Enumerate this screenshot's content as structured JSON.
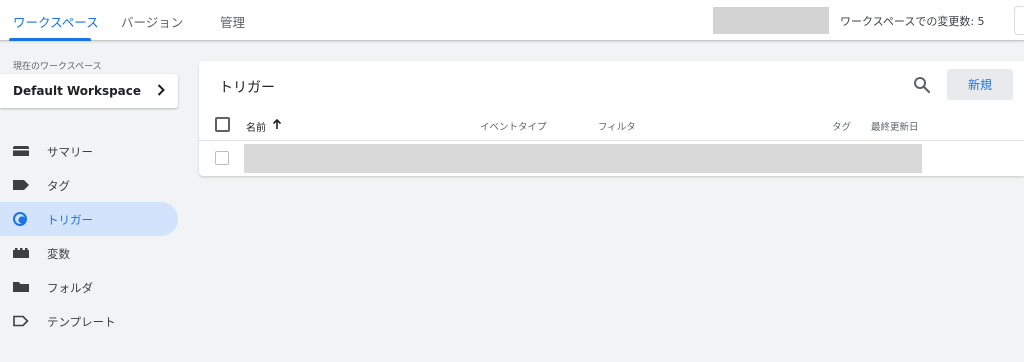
{
  "header": {
    "tabs": [
      {
        "label": "ワークスペース",
        "active": true
      },
      {
        "label": "バージョン",
        "active": false
      },
      {
        "label": "管理",
        "active": false
      }
    ],
    "variable_count_text": "ワークスペースでの変更数: 5"
  },
  "sidebar": {
    "workspace_caption": "現在のワークスペース",
    "workspace_name": "Default Workspace",
    "items": [
      {
        "label": "サマリー",
        "icon": "summary-folder-icon",
        "active": false
      },
      {
        "label": "タグ",
        "icon": "tag-icon",
        "active": false
      },
      {
        "label": "トリガー",
        "icon": "trigger-icon",
        "active": true
      },
      {
        "label": "変数",
        "icon": "variable-icon",
        "active": false
      },
      {
        "label": "フォルダ",
        "icon": "folder-icon",
        "active": false
      },
      {
        "label": "テンプレート",
        "icon": "template-icon",
        "active": false
      }
    ]
  },
  "main": {
    "title": "トリガー",
    "new_button_label": "新規",
    "columns": {
      "name": "名前",
      "event_type": "イベントタイプ",
      "filter": "フィルタ",
      "tag": "タグ",
      "last_updated": "最終更新日"
    }
  },
  "colors": {
    "accent": "#1a73e8",
    "active_nav_bg": "#d2e3fc",
    "page_bg": "#f1f3f4"
  }
}
